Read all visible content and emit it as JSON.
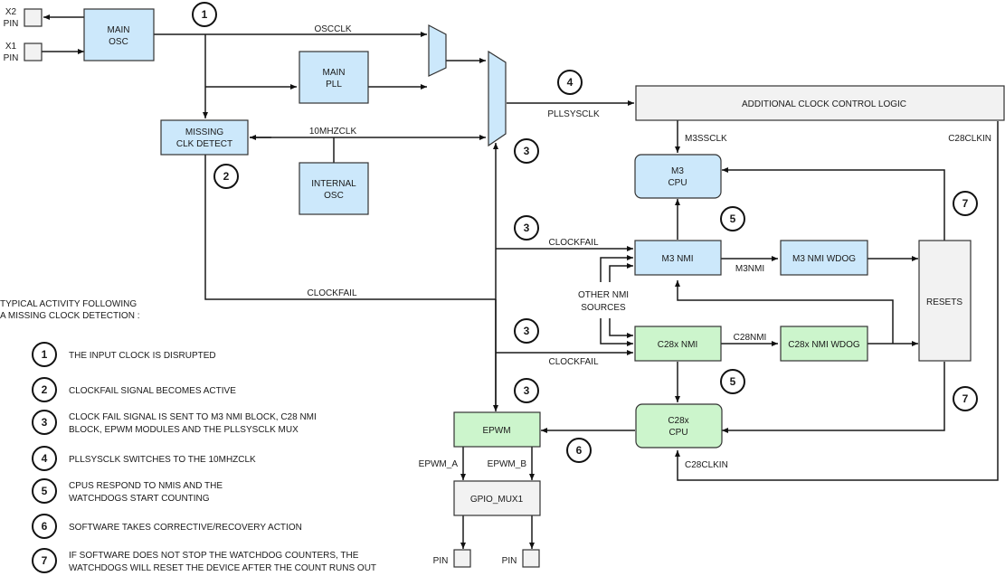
{
  "blocks": {
    "main_osc": [
      "MAIN",
      "OSC"
    ],
    "main_pll": [
      "MAIN",
      "PLL"
    ],
    "missing_clk_detect": [
      "MISSING",
      "CLK DETECT"
    ],
    "internal_osc": [
      "INTERNAL",
      "OSC"
    ],
    "additional_logic": "ADDITIONAL CLOCK CONTROL LOGIC",
    "m3_cpu": [
      "M3",
      "CPU"
    ],
    "m3_nmi": "M3 NMI",
    "m3_nmi_wdog": "M3 NMI WDOG",
    "c28_nmi": "C28x NMI",
    "c28_nmi_wdog": "C28x NMI WDOG",
    "resets": "RESETS",
    "c28_cpu": [
      "C28x",
      "CPU"
    ],
    "epwm": "EPWM",
    "gpio_mux": "GPIO_MUX1"
  },
  "pins": {
    "x2": [
      "X2",
      "PIN"
    ],
    "x1": [
      "X1",
      "PIN"
    ],
    "out": "PIN"
  },
  "signals": {
    "oscclk": "OSCCLK",
    "mhz10": "10MHZCLK",
    "pllsysclk": "PLLSYSCLK",
    "m3ssclk": "M3SSCLK",
    "c28clkin": "C28CLKIN",
    "clockfail": "CLOCKFAIL",
    "m3nmi": "M3NMI",
    "c28nmi": "C28NMI",
    "other_nmi": [
      "OTHER NMI",
      "SOURCES"
    ],
    "epwm_a": "EPWM_A",
    "epwm_b": "EPWM_B"
  },
  "markers": {
    "n1": "1",
    "n2": "2",
    "n3": "3",
    "n4": "4",
    "n5": "5",
    "n6": "6",
    "n7": "7"
  },
  "legend": {
    "title": [
      "TYPICAL ACTIVITY FOLLOWING",
      "A MISSING CLOCK DETECTION :"
    ],
    "items": [
      {
        "num": "1",
        "lines": [
          "THE INPUT CLOCK IS DISRUPTED"
        ]
      },
      {
        "num": "2",
        "lines": [
          "CLOCKFAIL SIGNAL BECOMES ACTIVE"
        ]
      },
      {
        "num": "3",
        "lines": [
          "CLOCK FAIL SIGNAL IS SENT TO M3 NMI BLOCK, C28 NMI",
          "BLOCK, EPWM MODULES AND THE PLLSYSCLK MUX"
        ]
      },
      {
        "num": "4",
        "lines": [
          "PLLSYSCLK SWITCHES TO THE 10MHZCLK"
        ]
      },
      {
        "num": "5",
        "lines": [
          "CPUS RESPOND TO NMIS AND THE",
          "WATCHDOGS START COUNTING"
        ]
      },
      {
        "num": "6",
        "lines": [
          "SOFTWARE TAKES CORRECTIVE/RECOVERY ACTION"
        ]
      },
      {
        "num": "7",
        "lines": [
          "IF SOFTWARE DOES NOT STOP THE WATCHDOG COUNTERS, THE",
          "WATCHDOGS WILL RESET THE DEVICE AFTER THE COUNT RUNS OUT"
        ]
      }
    ]
  }
}
